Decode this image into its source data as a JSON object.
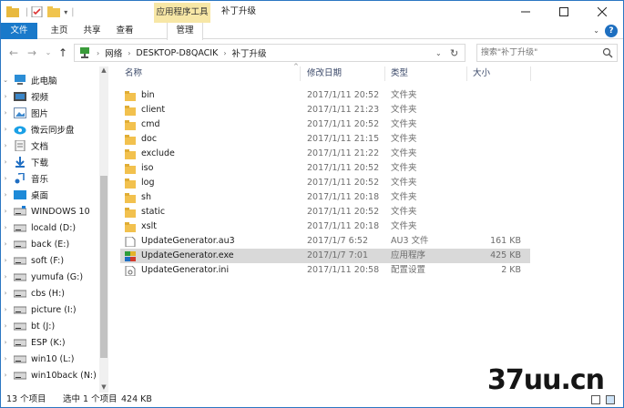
{
  "titlebar": {
    "title": "补丁升级",
    "context_tab": "应用程序工具"
  },
  "ribbon": {
    "tabs": [
      "文件",
      "主页",
      "共享",
      "查看",
      "管理"
    ],
    "help": "?"
  },
  "address": {
    "crumbs": [
      "网络",
      "DESKTOP-D8QACIK",
      "补丁升级"
    ],
    "search_placeholder": "搜索\"补丁升级\""
  },
  "sidebar": {
    "items": [
      {
        "label": "此电脑",
        "icon": "computer-icon"
      },
      {
        "label": "视频",
        "icon": "video-icon"
      },
      {
        "label": "图片",
        "icon": "pictures-icon"
      },
      {
        "label": "微云同步盘",
        "icon": "weiyun-icon"
      },
      {
        "label": "文档",
        "icon": "documents-icon"
      },
      {
        "label": "下载",
        "icon": "download-icon"
      },
      {
        "label": "音乐",
        "icon": "music-icon"
      },
      {
        "label": "桌面",
        "icon": "desktop-icon"
      },
      {
        "label": "WINDOWS 10",
        "icon": "drive-icon"
      },
      {
        "label": "locald (D:)",
        "icon": "drive-icon"
      },
      {
        "label": "back (E:)",
        "icon": "drive-icon"
      },
      {
        "label": "soft (F:)",
        "icon": "drive-icon"
      },
      {
        "label": "yumufa (G:)",
        "icon": "drive-icon"
      },
      {
        "label": "cbs (H:)",
        "icon": "drive-icon"
      },
      {
        "label": "picture (I:)",
        "icon": "drive-icon"
      },
      {
        "label": "bt (J:)",
        "icon": "drive-icon"
      },
      {
        "label": "ESP (K:)",
        "icon": "drive-icon"
      },
      {
        "label": "win10 (L:)",
        "icon": "drive-icon"
      },
      {
        "label": "win10back (N:)",
        "icon": "drive-icon"
      }
    ]
  },
  "columns": [
    "名称",
    "修改日期",
    "类型",
    "大小"
  ],
  "files": [
    {
      "name": "bin",
      "date": "2017/1/11 20:52",
      "type": "文件夹",
      "size": "",
      "kind": "folder"
    },
    {
      "name": "client",
      "date": "2017/1/11 21:23",
      "type": "文件夹",
      "size": "",
      "kind": "folder"
    },
    {
      "name": "cmd",
      "date": "2017/1/11 20:52",
      "type": "文件夹",
      "size": "",
      "kind": "folder"
    },
    {
      "name": "doc",
      "date": "2017/1/11 21:15",
      "type": "文件夹",
      "size": "",
      "kind": "folder"
    },
    {
      "name": "exclude",
      "date": "2017/1/11 21:22",
      "type": "文件夹",
      "size": "",
      "kind": "folder"
    },
    {
      "name": "iso",
      "date": "2017/1/11 20:52",
      "type": "文件夹",
      "size": "",
      "kind": "folder"
    },
    {
      "name": "log",
      "date": "2017/1/11 20:52",
      "type": "文件夹",
      "size": "",
      "kind": "folder"
    },
    {
      "name": "sh",
      "date": "2017/1/11 20:18",
      "type": "文件夹",
      "size": "",
      "kind": "folder"
    },
    {
      "name": "static",
      "date": "2017/1/11 20:52",
      "type": "文件夹",
      "size": "",
      "kind": "folder"
    },
    {
      "name": "xslt",
      "date": "2017/1/11 20:18",
      "type": "文件夹",
      "size": "",
      "kind": "folder"
    },
    {
      "name": "UpdateGenerator.au3",
      "date": "2017/1/7 6:52",
      "type": "AU3 文件",
      "size": "161 KB",
      "kind": "file"
    },
    {
      "name": "UpdateGenerator.exe",
      "date": "2017/1/7 7:01",
      "type": "应用程序",
      "size": "425 KB",
      "kind": "exe",
      "selected": true
    },
    {
      "name": "UpdateGenerator.ini",
      "date": "2017/1/11 20:58",
      "type": "配置设置",
      "size": "2 KB",
      "kind": "ini"
    }
  ],
  "status": {
    "count": "13 个项目",
    "selected": "选中 1 个项目",
    "size": "424 KB"
  },
  "watermark": "37uu.cn"
}
